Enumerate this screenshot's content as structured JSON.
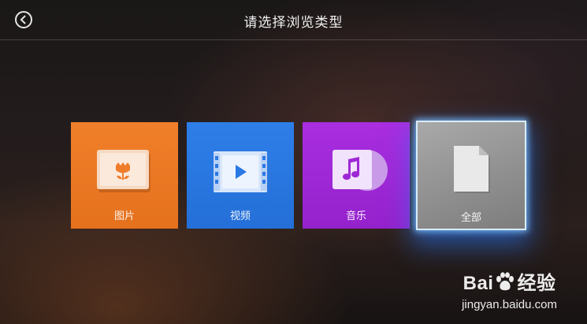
{
  "header": {
    "title": "请选择浏览类型",
    "back_icon": "back-arrow-circle-icon"
  },
  "tiles": [
    {
      "label": "图片",
      "icon": "picture-flower-icon",
      "color": "#EE7A25"
    },
    {
      "label": "视频",
      "icon": "video-film-icon",
      "color": "#2A78E4"
    },
    {
      "label": "音乐",
      "icon": "music-album-icon",
      "color": "#A028D8"
    },
    {
      "label": "全部",
      "icon": "file-icon",
      "color": "#9A9A9A",
      "selected": true
    }
  ],
  "watermark": {
    "logo_text_left": "Bai",
    "logo_text_right": "经验",
    "url": "jingyan.baidu.com"
  }
}
